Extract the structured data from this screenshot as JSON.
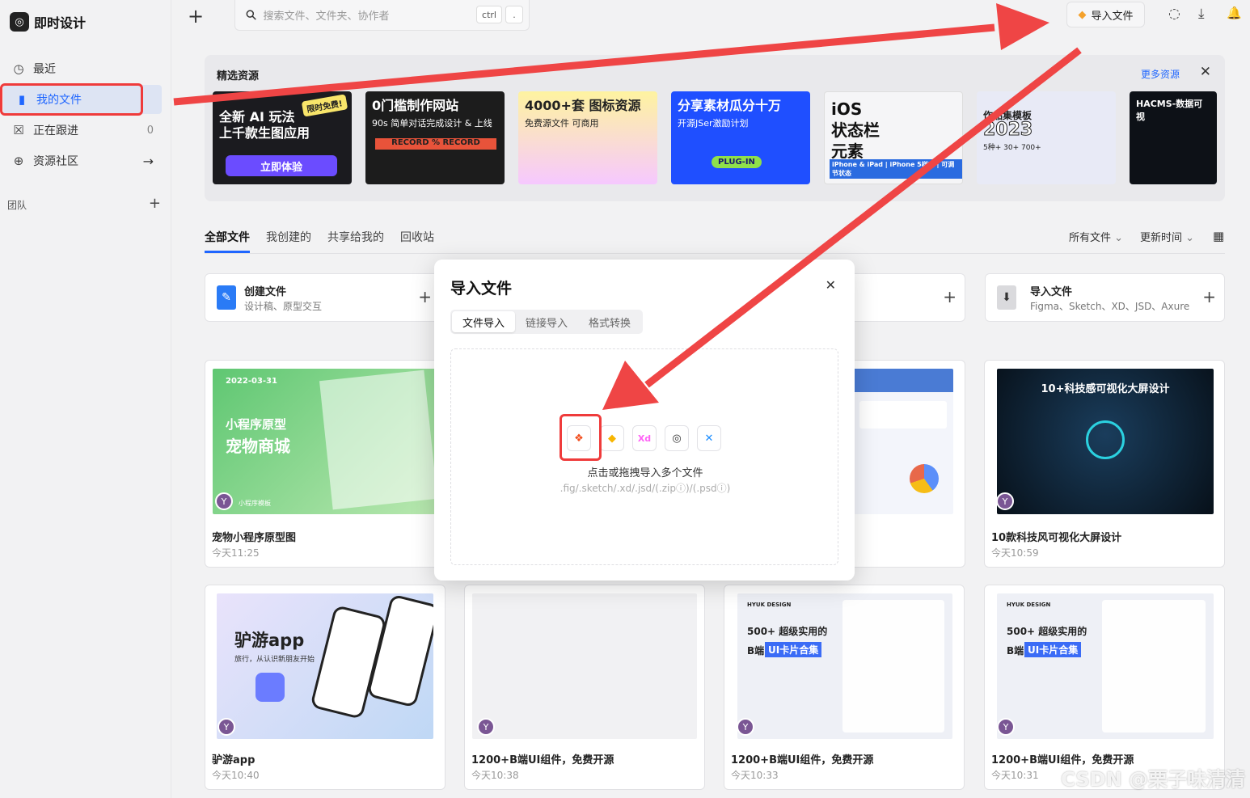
{
  "app": {
    "logo_glyph": "◎",
    "name": "即时设计"
  },
  "sidebar": {
    "items": [
      {
        "label": "最近",
        "icon": "clock-icon",
        "glyph": "◷"
      },
      {
        "label": "我的文件",
        "icon": "file-icon",
        "glyph": "▮"
      },
      {
        "label": "正在跟进",
        "icon": "follow-icon",
        "glyph": "☒",
        "count": "0"
      },
      {
        "label": "资源社区",
        "icon": "globe-icon",
        "glyph": "⊕",
        "arrow": "→"
      }
    ],
    "team_label": "团队",
    "team_add": "+"
  },
  "topbar": {
    "new_glyph": "+",
    "search_placeholder": "搜索文件、文件夹、协作者",
    "search_icon": "⚲",
    "kbd_ctrl": "ctrl",
    "kbd_dot": ".",
    "import_label": "导入文件",
    "import_icon": "◆",
    "icons": [
      {
        "name": "bulb-icon",
        "glyph": "◌"
      },
      {
        "name": "download-icon",
        "glyph": "⤓"
      },
      {
        "name": "bell-icon",
        "glyph": "🔔"
      }
    ]
  },
  "featured": {
    "title": "精选资源",
    "more": "更多资源",
    "close": "✕",
    "cards": [
      {
        "l1": "全新 AI 玩法",
        "l2": "上千款生图应用",
        "btn": "立即体验",
        "badge": "限时免费!",
        "bg": "#1b1b1f"
      },
      {
        "l1": "0门槛制作网站",
        "l2": "90s 简单对话完成设计 & 上线",
        "l3": "RECORD % RECORD",
        "bg": "#1c1c1c"
      },
      {
        "l1": "4000+套 图标资源",
        "l2": "免费源文件  可商用",
        "bg": "#fef3a0"
      },
      {
        "l1": "分享素材瓜分十万",
        "l2": "开源JSer激励计划",
        "l3": "PLUG-IN",
        "bg": "#1f4fff"
      },
      {
        "l1": "iOS",
        "l2": "状态栏",
        "l3": "元素",
        "l4": "iPhone & iPad | iPhone 5样式 | 可调节状态",
        "bg": "#f5f5f7"
      },
      {
        "l1": "作品集模板",
        "l2": "2023",
        "l3": "5种+  30+  700+",
        "bg": "#e8eaf6"
      },
      {
        "l1": "HACMS-数据可视",
        "bg": "#0d1117"
      }
    ]
  },
  "tabs": [
    "全部文件",
    "我创建的",
    "共享给我的",
    "回收站"
  ],
  "filters": {
    "all": "所有文件",
    "sort": "更新时间",
    "grid_icon": "▦"
  },
  "actions": [
    {
      "title": "创建文件",
      "sub": "设计稿、原型交互",
      "plus": "+",
      "glyph": "✎"
    },
    {
      "plus": "+"
    },
    {
      "title": "导入文件",
      "sub": "Figma、Sketch、XD、JSD、Axure",
      "plus": "+",
      "glyph": "⬇"
    }
  ],
  "files": [
    {
      "name": "宠物小程序原型图",
      "time": "今天11:25",
      "date": "2022-03-31",
      "t1": "小程序原型",
      "t2": "宠物商城",
      "tag": "小程序模板",
      "avatar": "Y"
    },
    {
      "name": "10款科技风可视化大屏设计",
      "time": "今天10:59",
      "t1": "10+科技感可视化大屏设计",
      "avatar": "Y"
    },
    {
      "name": "驴游app",
      "time": "今天10:40",
      "t1": "驴游app",
      "t2": "旅行，从认识新朋友开始",
      "avatar": "Y"
    },
    {
      "name": "1200+B端UI组件，免费开源",
      "time": "今天10:38",
      "avatar": "Y"
    },
    {
      "name": "1200+B端UI组件，免费开源",
      "time": "今天10:33",
      "brand": "HYUK DESIGN",
      "t1": "500+ 超级实用的",
      "t2": "B端",
      "t3": "UI卡片合集",
      "avatar": "Y"
    },
    {
      "name": "1200+B端UI组件，免费开源",
      "time": "今天10:31",
      "brand": "HYUK DESIGN",
      "t1": "500+ 超级实用的",
      "t2": "B端",
      "t3": "UI卡片合集",
      "avatar": "Y"
    }
  ],
  "modal": {
    "title": "导入文件",
    "close": "✕",
    "tabs": [
      "文件导入",
      "链接导入",
      "格式转换"
    ],
    "formats": [
      {
        "name": "figma-icon",
        "glyph": "❖",
        "color": "#f24e1e"
      },
      {
        "name": "sketch-icon",
        "glyph": "◆",
        "color": "#f7b500"
      },
      {
        "name": "xd-icon",
        "glyph": "Xd",
        "color": "#ff61f6"
      },
      {
        "name": "jsd-icon",
        "glyph": "◎",
        "color": "#333333"
      },
      {
        "name": "axure-icon",
        "glyph": "✕",
        "color": "#1a8cff"
      }
    ],
    "hint": "点击或拖拽导入多个文件",
    "ext": ".fig/.sketch/.xd/.jsd/(.zipⓘ)/(.psdⓘ)"
  },
  "watermark": "CSDN @栗子味清清",
  "colors": {
    "accent": "#1f66ff",
    "annotation": "#ef3b3b"
  }
}
